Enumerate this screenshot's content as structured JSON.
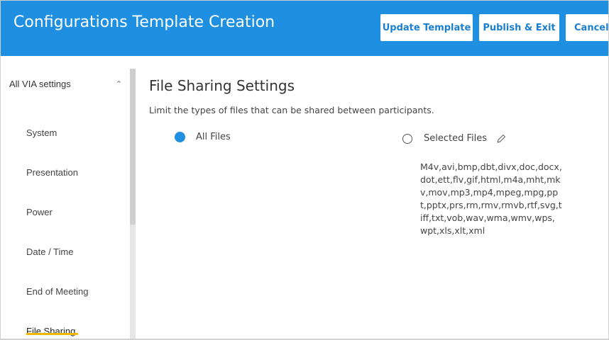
{
  "header": {
    "title": "Configurations Template Creation",
    "update_label": "Update Template",
    "publish_label": "Publish & Exit",
    "cancel_label": "Cancel",
    "bg_color": "#1e8fe1"
  },
  "sidebar": {
    "header_label": "All VIA settings",
    "header_icon": "chevron-up-icon",
    "items": [
      {
        "label": "System"
      },
      {
        "label": "Presentation"
      },
      {
        "label": "Power"
      },
      {
        "label": "Date / Time"
      },
      {
        "label": "End of Meeting"
      },
      {
        "label": "File Sharing",
        "active": true
      }
    ],
    "active_color": "#f5b800"
  },
  "main": {
    "title": "File Sharing Settings",
    "description": "Limit the types of files that can be shared between participants.",
    "options": [
      {
        "label": "All Files",
        "selected": true
      },
      {
        "label": "Selected Files",
        "selected": false,
        "icon": "pencil-icon"
      }
    ],
    "file_types": "M4v,avi,bmp,dbt,divx,doc,docx,dot,ett,flv,gif,html,m4a,mht,mkv,mov,mp3,mp4,mpeg,mpg,ppt,pptx,prs,rm,rmv,rmvb,rtf,svg,tiff,txt,vob,wav,wma,wmv,wps,wpt,xls,xlt,xml"
  }
}
